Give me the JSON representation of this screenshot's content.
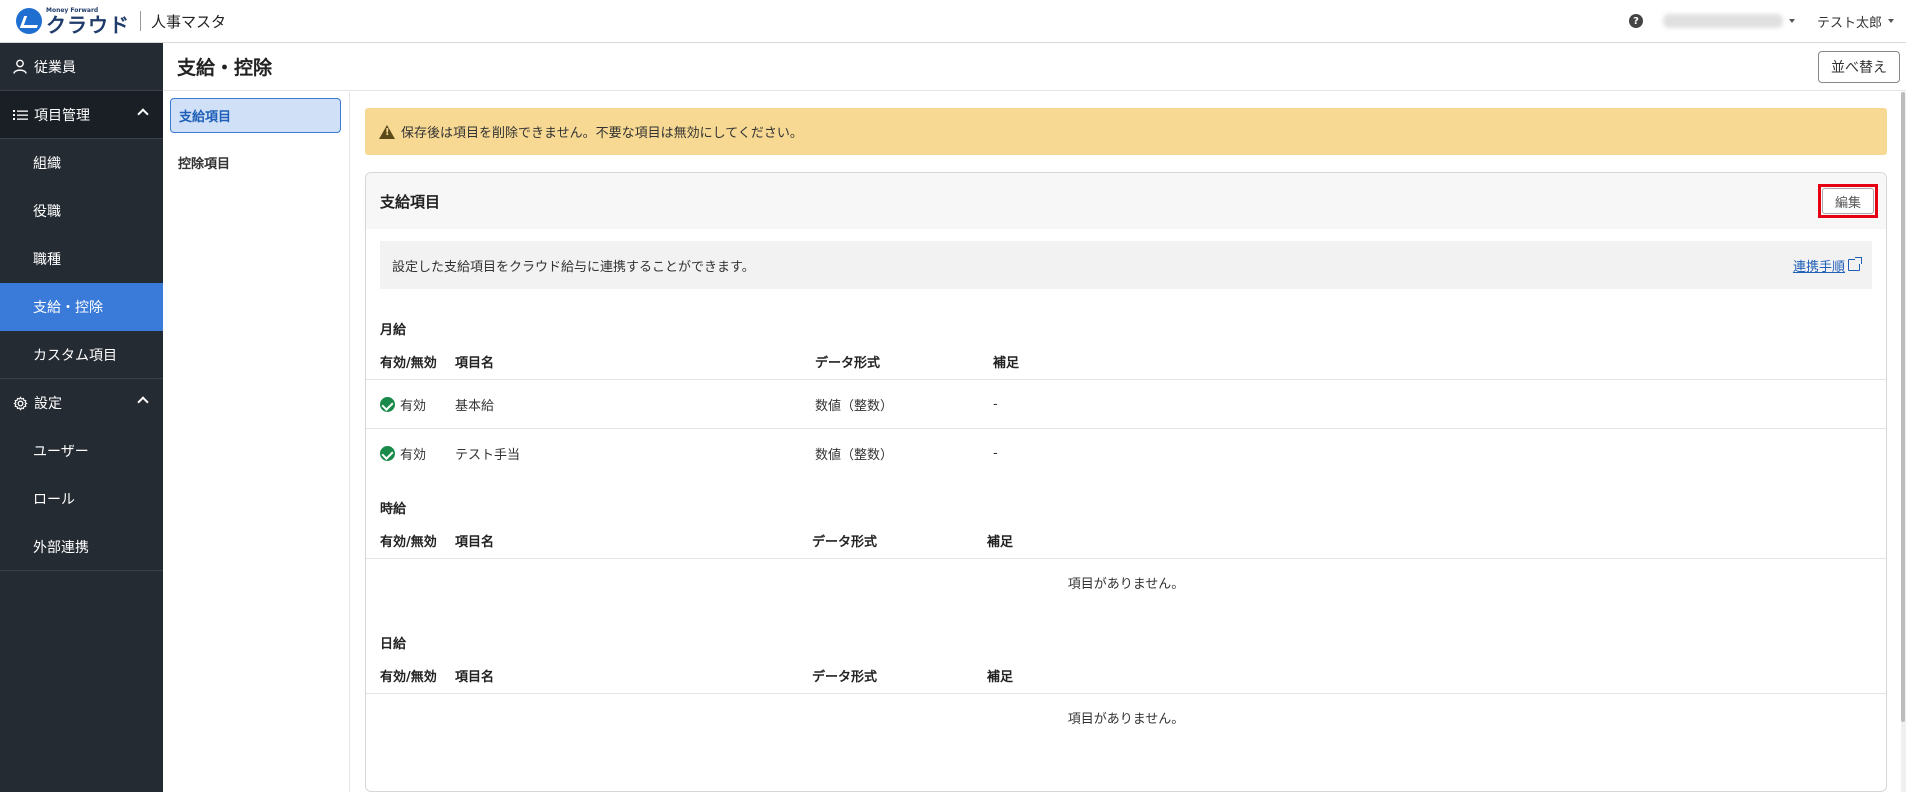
{
  "header": {
    "brand_small": "Money Forward",
    "brand_main": "クラウド",
    "app_name": "人事マスタ",
    "help_label": "?",
    "user_name": "テスト太郎"
  },
  "sidebar": {
    "employees": "従業員",
    "items_group": "項目管理",
    "items_sub": [
      "組織",
      "役職",
      "職種",
      "支給・控除",
      "カスタム項目"
    ],
    "settings_group": "設定",
    "settings_sub": [
      "ユーザー",
      "ロール",
      "外部連携"
    ]
  },
  "page": {
    "title": "支給・控除",
    "sort_label": "並べ替え"
  },
  "subnav": {
    "items": [
      "支給項目",
      "控除項目"
    ]
  },
  "alert": {
    "text": "保存後は項目を削除できません。不要な項目は無効にしてください。"
  },
  "card": {
    "title": "支給項目",
    "edit_label": "編集",
    "info_text": "設定した支給項目をクラウド給与に連携することができます。",
    "info_link": "連携手順"
  },
  "columns": [
    "有効/無効",
    "項目名",
    "データ形式",
    "補足"
  ],
  "sections": [
    {
      "title": "月給",
      "rows": [
        {
          "status": "有効",
          "name": "基本給",
          "format": "数値（整数）",
          "note": "-"
        },
        {
          "status": "有効",
          "name": "テスト手当",
          "format": "数値（整数）",
          "note": "-"
        }
      ]
    },
    {
      "title": "時給",
      "empty": "項目がありません。"
    },
    {
      "title": "日給",
      "empty": "項目がありません。"
    }
  ],
  "colors": {
    "sidebar_bg": "#252b33",
    "active_blue": "#3a7ad9",
    "alert_bg": "#f7d993",
    "success_green": "#1a8a4a",
    "highlight_red": "#e60012"
  }
}
